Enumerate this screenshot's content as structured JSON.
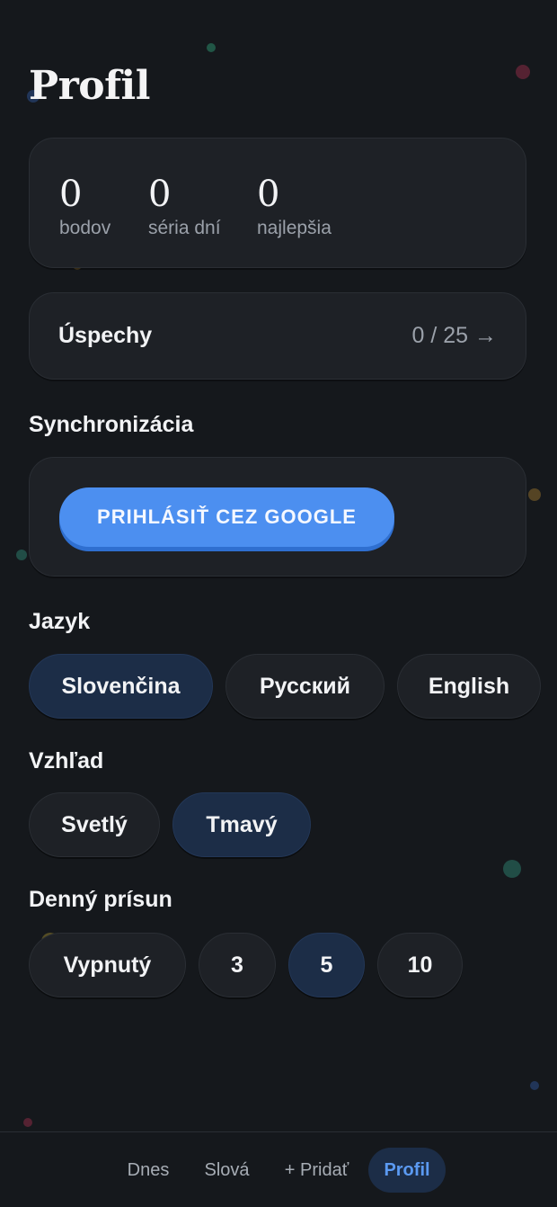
{
  "page": {
    "title": "Profil"
  },
  "stats": [
    {
      "value": "0",
      "label": "bodov"
    },
    {
      "value": "0",
      "label": "séria dní"
    },
    {
      "value": "0",
      "label": "najlepšia"
    }
  ],
  "achievements": {
    "label": "Úspechy",
    "count": "0 / 25 →"
  },
  "sync": {
    "heading": "Synchronizácia",
    "google_button_label": "PRIHLÁSIŤ CEZ GOOGLE"
  },
  "language": {
    "heading": "Jazyk",
    "options": [
      "Slovenčina",
      "Русский",
      "English"
    ],
    "selected": "Slovenčina"
  },
  "appearance": {
    "heading": "Vzhľad",
    "options": [
      "Svetlý",
      "Tmavý"
    ],
    "selected": "Tmavý"
  },
  "daily": {
    "heading": "Denný prísun",
    "options": [
      "Vypnutý",
      "3",
      "5",
      "10"
    ],
    "selected": "5"
  },
  "nav": {
    "items": [
      "Dnes",
      "Slová",
      "+ Pridať",
      "Profil"
    ],
    "active": "Profil"
  },
  "colors": {
    "background": "#15181c",
    "card": "#1e2126",
    "accent": "#4c8ff0",
    "selected_pill": "#1c2d47",
    "active_nav_text": "#5b9af2"
  }
}
